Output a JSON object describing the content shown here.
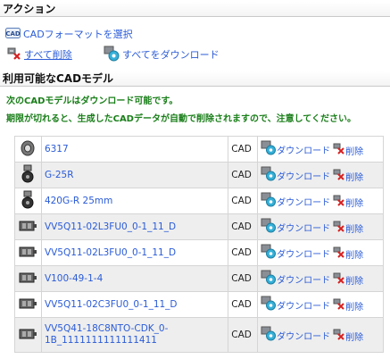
{
  "actions": {
    "title": "アクション",
    "select_cad_format": "CADフォーマットを選択",
    "delete_all": "すべて削除",
    "download_all": "すべてをダウンロード"
  },
  "models": {
    "title": "利用可能なCADモデル",
    "notice_line1": "次のCADモデルはダウンロード可能です。",
    "notice_line2": "期限が切れると、生成したCADデータが自動で削除されますので、注意してください。",
    "download_label": "ダウンロード",
    "delete_label": "削除",
    "rows": [
      {
        "name": "6317",
        "format": "CAD",
        "thumb": "bearing-thumb"
      },
      {
        "name": "G-25R",
        "format": "CAD",
        "thumb": "caster-thumb"
      },
      {
        "name": "420G-R 25mm",
        "format": "CAD",
        "thumb": "caster-thumb"
      },
      {
        "name": "VV5Q11-02L3FU0_0-1_11_D",
        "format": "CAD",
        "thumb": "valve-thumb"
      },
      {
        "name": "VV5Q11-02L3FU0_0-1_11_D",
        "format": "CAD",
        "thumb": "valve-thumb"
      },
      {
        "name": "V100-49-1-4",
        "format": "CAD",
        "thumb": "valve-thumb"
      },
      {
        "name": "VV5Q11-02C3FU0_0-1_11_D",
        "format": "CAD",
        "thumb": "valve-thumb"
      },
      {
        "name": "VV5Q41-18C8NTO-CDK_0-1B_1111111111111411",
        "format": "CAD",
        "thumb": "valve-thumb"
      }
    ]
  },
  "colors": {
    "link": "#2a5bd7",
    "notice": "#1a7f1a",
    "row_alt": "#eeeeee"
  }
}
